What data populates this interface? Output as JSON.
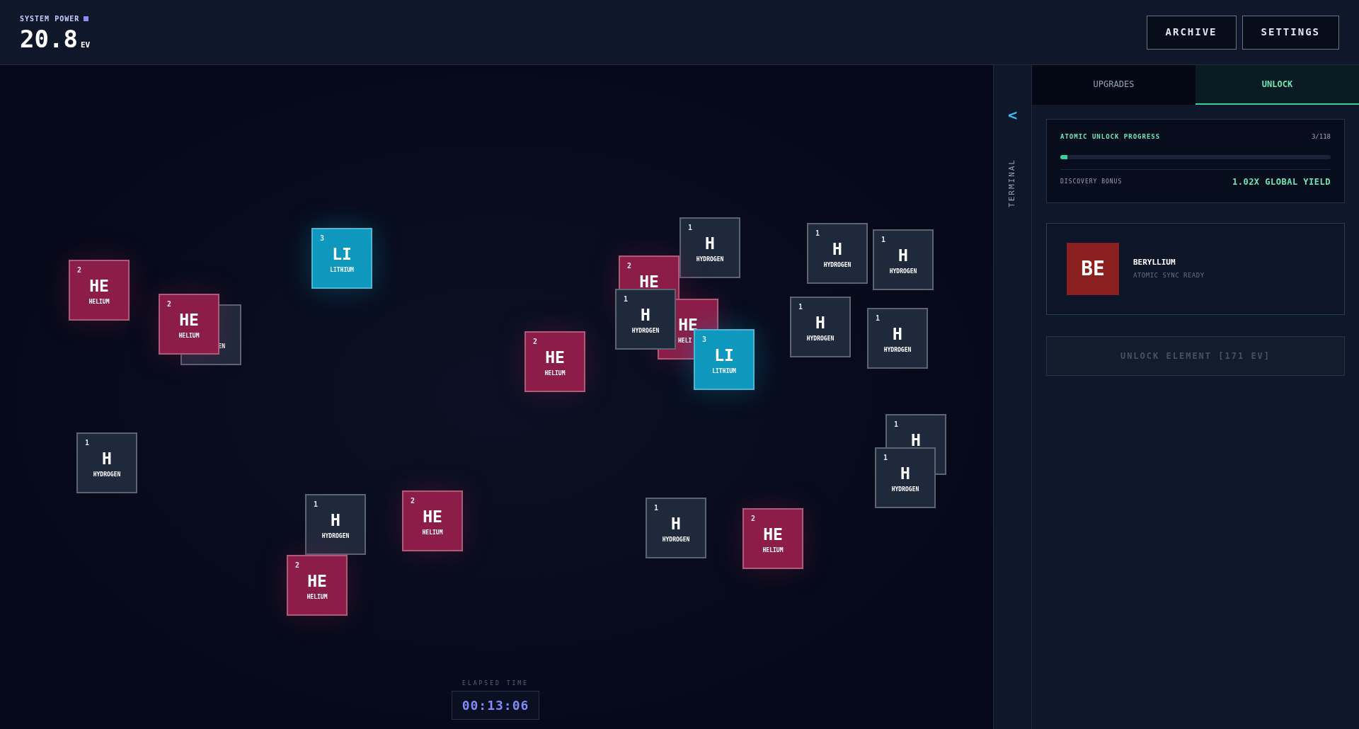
{
  "header": {
    "label": "SYSTEM POWER",
    "power": "20.8",
    "unit": "EV",
    "buttons": [
      "ARCHIVE",
      "SETTINGS"
    ]
  },
  "canvas": {
    "tiles": [
      {
        "number": "2",
        "symbol": "HE",
        "name": "HELIUM",
        "color": "#8c1c48"
      },
      {
        "name": "EN",
        "color": "#1e293b"
      },
      {
        "number": "2",
        "symbol": "HE",
        "name": "HELIUM",
        "color": "#8c1c48"
      },
      {
        "number": "3",
        "symbol": "LI",
        "name": "LITHIUM",
        "color": "#0e98be"
      },
      {
        "number": "1",
        "symbol": "H",
        "name": "HYDROGEN",
        "color": "#1e293b"
      },
      {
        "number": "1",
        "symbol": "H",
        "name": "HYDROGEN",
        "color": "#1e293b"
      },
      {
        "number": "2",
        "symbol": "HE",
        "name": "HELIUM",
        "color": "#8c1c48"
      },
      {
        "number": "2",
        "symbol": "HE",
        "name": "HELIUM",
        "color": "#8c1c48"
      },
      {
        "number": "2",
        "symbol": "HE",
        "name": "HELIUM",
        "color": "#8c1c48"
      },
      {
        "number": "1",
        "symbol": "H",
        "name": "HYDROGEN",
        "color": "#1e293b"
      },
      {
        "number": "2",
        "symbol": "HE",
        "color": "#8c1c48"
      },
      {
        "symbol": "HE",
        "name": "HELI",
        "color": "#8c1c48"
      },
      {
        "number": "1",
        "symbol": "H",
        "name": "HYDROGEN",
        "color": "#1e293b"
      },
      {
        "number": "3",
        "symbol": "LI",
        "name": "LITHIUM",
        "color": "#0e98be"
      },
      {
        "number": "1",
        "symbol": "H",
        "name": "HYDROGEN",
        "color": "#1e293b"
      },
      {
        "number": "1",
        "symbol": "H",
        "name": "HYDROGEN",
        "color": "#1e293b"
      },
      {
        "number": "1",
        "symbol": "H",
        "name": "HYDROGEN",
        "color": "#1e293b"
      },
      {
        "number": "1",
        "symbol": "H",
        "name": "HYDROGEN",
        "color": "#1e293b"
      },
      {
        "number": "1",
        "symbol": "H",
        "color": "#1e293b"
      },
      {
        "number": "1",
        "symbol": "H",
        "name": "HYDROGEN",
        "color": "#1e293b"
      },
      {
        "number": "1",
        "symbol": "H",
        "name": "HYDROGEN",
        "color": "#1e293b"
      },
      {
        "number": "2",
        "symbol": "HE",
        "name": "HELIUM",
        "color": "#8c1c48"
      }
    ],
    "elapsed": {
      "label": "ELAPSED TIME",
      "time": "00:13:06"
    }
  },
  "sidebar": {
    "toggle": "<",
    "label": "TERMINAL"
  },
  "panel": {
    "tabs": [
      {
        "label": "UPGRADES",
        "selected": false
      },
      {
        "label": "UNLOCK",
        "selected": true
      }
    ],
    "progress": {
      "title": "ATOMIC UNLOCK PROGRESS",
      "count": "3/118",
      "level": 0.025,
      "bonus_label": "DISCOVERY BONUS",
      "bonus_value": "1.02X GLOBAL YIELD"
    },
    "next_element": {
      "symbol": "BE",
      "name": "BERYLLIUM",
      "status": "ATOMIC SYNC READY",
      "color": "#8b1e1e"
    },
    "unlock_button": {
      "label": "UNLOCK ELEMENT [171 EV]",
      "disabled": true
    }
  }
}
